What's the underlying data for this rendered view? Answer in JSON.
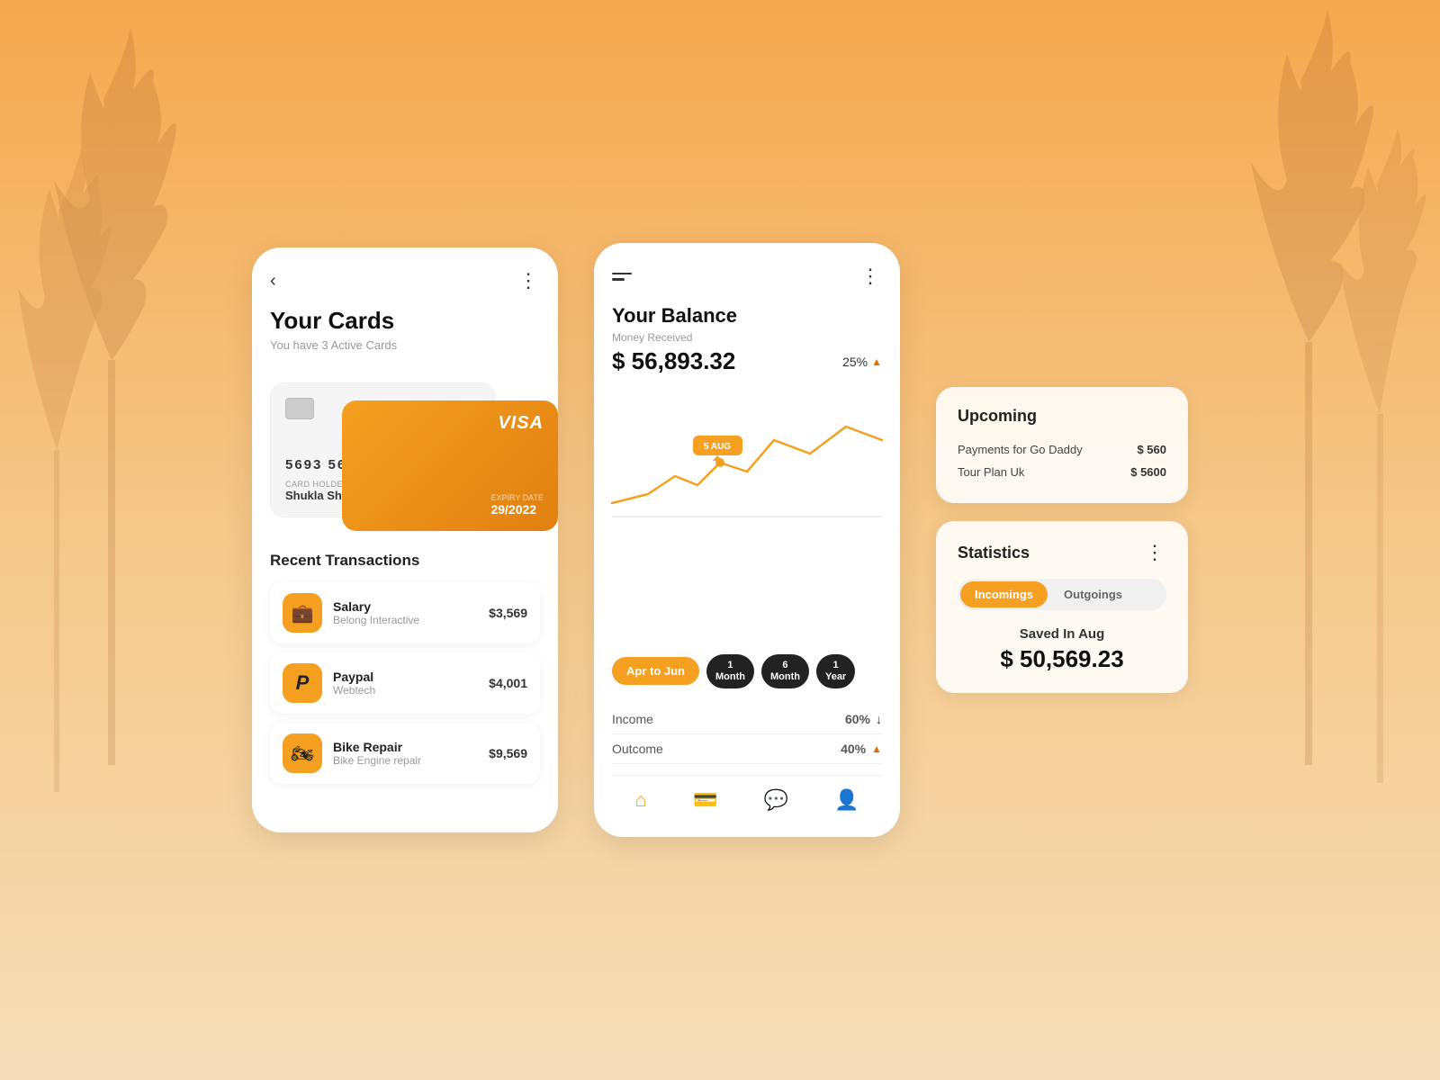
{
  "background": {
    "gradient_start": "#f5a84e",
    "gradient_end": "#f5ddb8"
  },
  "cards_screen": {
    "title": "Your Cards",
    "subtitle": "You have 3 Active Cards",
    "card_back": {
      "number": "5693 5692 0007 5269",
      "holder_label": "CARD HOLDER",
      "holder_name": "Shukla Shah",
      "expiry_label": "Expiry Date",
      "expiry_value": "29/2022",
      "network": "VISA"
    },
    "card_front": {
      "network": "VISA",
      "expiry_label": "Expiry Date",
      "expiry_value": "29/2022"
    },
    "recent_transactions_title": "Recent Transactions",
    "transactions": [
      {
        "name": "Salary",
        "sub": "Belong Interactive",
        "amount": "$3,569",
        "icon": "💼"
      },
      {
        "name": "Paypal",
        "sub": "Webtech",
        "amount": "$4,001",
        "icon": "🅿"
      },
      {
        "name": "Bike Repair",
        "sub": "Bike Engine repair",
        "amount": "$9,569",
        "icon": "🏍"
      }
    ]
  },
  "balance_screen": {
    "title": "Your Balance",
    "money_received_label": "Money Received",
    "balance_amount": "$ 56,893.32",
    "balance_pct": "25%",
    "chart_tooltip_date": "5 AUG",
    "period_buttons": [
      {
        "label": "Apr to Jun",
        "style": "orange"
      },
      {
        "label": "1\nMonth",
        "style": "dark"
      },
      {
        "label": "6\nMonth",
        "style": "dark"
      },
      {
        "label": "1\nYear",
        "style": "dark"
      }
    ],
    "income_label": "Income",
    "income_pct": "60%",
    "outcome_label": "Outcome",
    "outcome_pct": "40%",
    "nav_icons": [
      "home",
      "card",
      "chat",
      "profile"
    ]
  },
  "upcoming": {
    "title": "Upcoming",
    "items": [
      {
        "name": "Payments for Go Daddy",
        "amount": "$ 560"
      },
      {
        "name": "Tour Plan Uk",
        "amount": "$ 5600"
      }
    ]
  },
  "statistics": {
    "title": "Statistics",
    "toggle_options": [
      "Incomings",
      "Outgoings"
    ],
    "active_toggle": "Incomings",
    "saved_label": "Saved In Aug",
    "saved_amount": "$ 50,569.23"
  }
}
